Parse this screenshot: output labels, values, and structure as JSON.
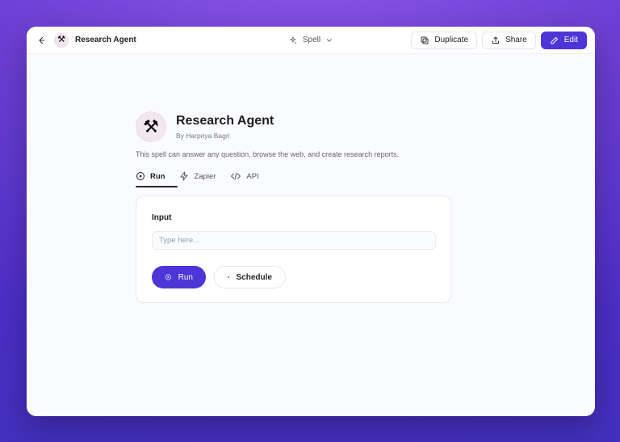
{
  "topbar": {
    "back_icon": "arrow-left-icon",
    "agent_icon": "tools-icon",
    "title": "Research Agent",
    "spell_label": "Spell",
    "buttons": {
      "duplicate": "Duplicate",
      "share": "Share",
      "edit": "Edit"
    }
  },
  "agent": {
    "title": "Research Agent",
    "byline": "By Harpriya Bagri",
    "description": "This spell can answer any question, browse the web, and create research reports."
  },
  "tabs": [
    {
      "label": "Run",
      "icon": "play-circle-icon",
      "active": true
    },
    {
      "label": "Zapier",
      "icon": "bolt-icon",
      "active": false
    },
    {
      "label": "API",
      "icon": "code-icon",
      "active": false
    }
  ],
  "card": {
    "input_label": "Input",
    "input_placeholder": "Type here...",
    "run_button": "Run",
    "schedule_button": "Schedule"
  },
  "colors": {
    "accent": "#4d35d8",
    "background_gradient": [
      "#8b55e8",
      "#4130b9"
    ]
  }
}
